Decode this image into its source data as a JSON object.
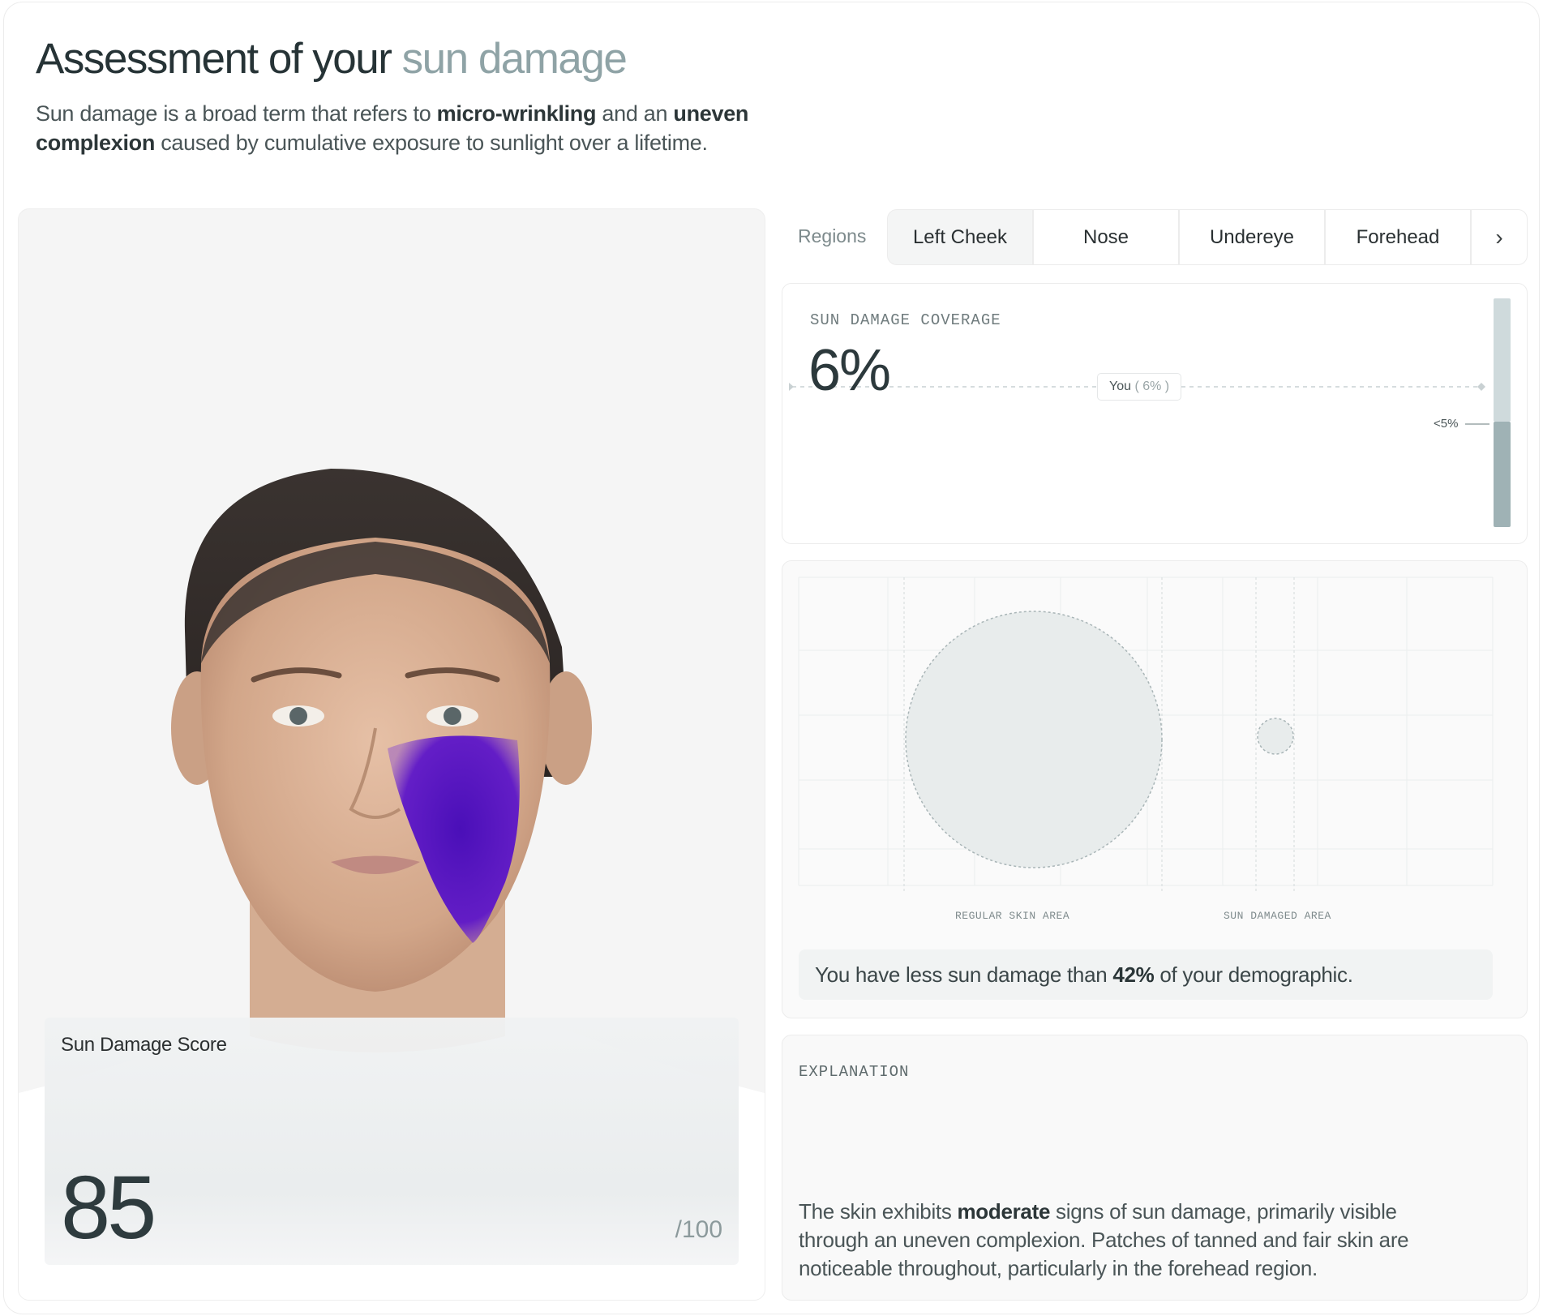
{
  "header": {
    "title_main": "Assessment of your",
    "title_accent": "sun damage",
    "intro_part1": "Sun damage is a broad term that refers to ",
    "intro_bold1": "micro-wrinkling",
    "intro_part2": " and an ",
    "intro_bold2": "uneven complexion",
    "intro_part3": " caused by cumulative exposure to sunlight over a lifetime."
  },
  "score": {
    "label": "Sun Damage Score",
    "value": "85",
    "max": "/100"
  },
  "regions": {
    "label": "Regions",
    "tabs": [
      "Left Cheek",
      "Nose",
      "Undereye",
      "Forehead"
    ],
    "active": "Left Cheek",
    "next_icon": "chevron-right-icon"
  },
  "coverage": {
    "caption": "SUN DAMAGE COVERAGE",
    "value": "6%",
    "you_label": "You",
    "you_value": "( 6% )",
    "threshold_label": "<5%",
    "level_fraction": 0.06
  },
  "comparison": {
    "regular_label": "REGULAR SKIN AREA",
    "damaged_label": "SUN DAMAGED AREA",
    "demo_prefix": "You have less sun damage than ",
    "demo_percent": "42%",
    "demo_suffix": " of your demographic."
  },
  "explanation": {
    "caption": "EXPLANATION",
    "part1": "The skin exhibits ",
    "bold": "moderate",
    "part2": " signs of sun damage, primarily visible through an uneven complexion. Patches of tanned and fair skin are noticeable throughout, particularly in the forehead region."
  },
  "colors": {
    "accent_title": "#8fa3a6",
    "overlay_purple": "#5a12c8",
    "gauge_light": "#cfdadc",
    "gauge_dark": "#9fb2b5"
  }
}
